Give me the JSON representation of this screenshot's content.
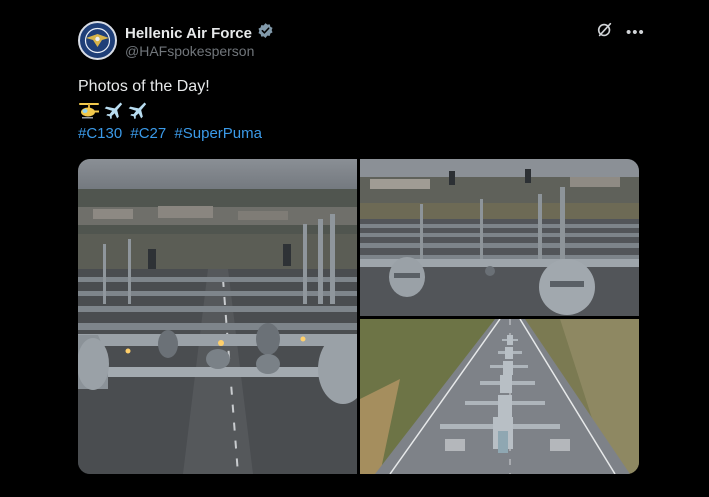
{
  "post": {
    "author_name": "Hellenic Air Force",
    "author_handle": "@HAFspokesperson",
    "text": "Photos of the Day!",
    "hashtags": [
      "#C130",
      "#C27",
      "#SuperPuma"
    ],
    "emoji_icons": [
      "helicopter-icon",
      "airplane-icon",
      "airplane-icon"
    ]
  },
  "icons": {
    "verified": "verified-badge-icon",
    "grok": "grok-icon",
    "more": "more-options-icon"
  },
  "media": {
    "photos": [
      "aircraft-elephant-walk-photo",
      "aircraft-lineup-front-photo",
      "aircraft-runway-aerial-photo"
    ]
  },
  "colors": {
    "background": "#000000",
    "text": "#e7e9ea",
    "secondary": "#71767b",
    "link": "#3b9ae8",
    "verified": "#829aab"
  }
}
